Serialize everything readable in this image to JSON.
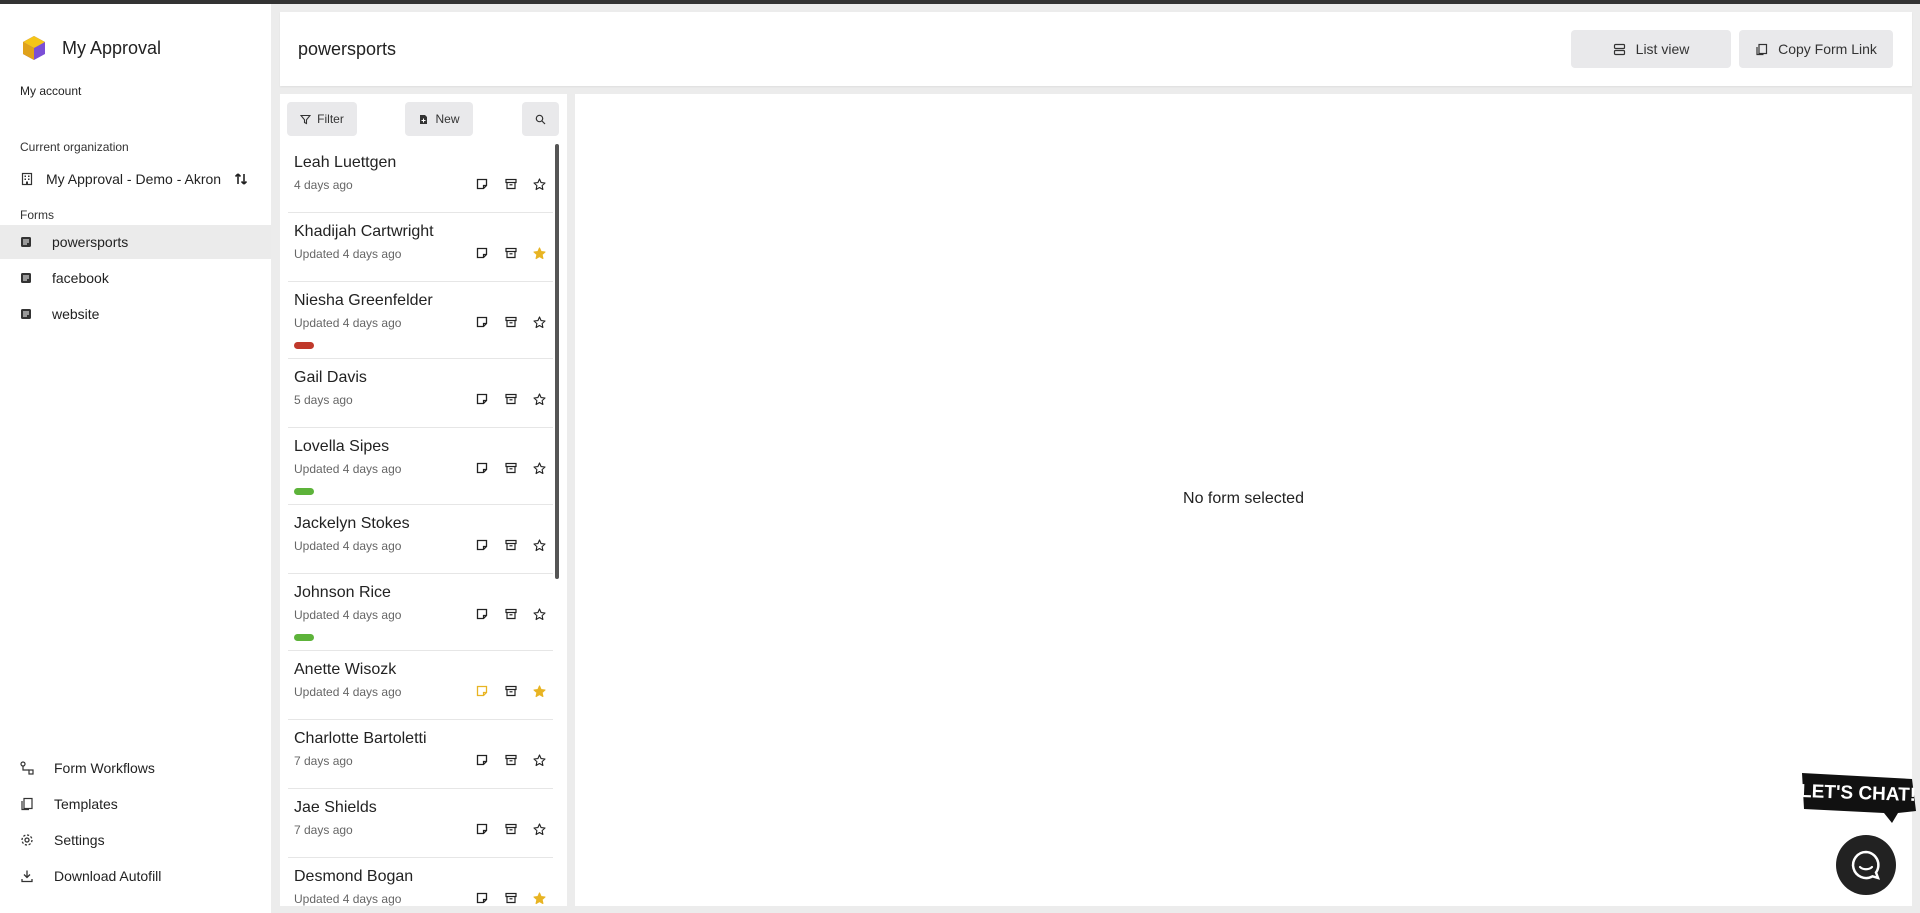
{
  "app": {
    "title": "My Approval",
    "brand_colors": [
      "#f5c518",
      "#7b4fd6"
    ]
  },
  "sidebar": {
    "my_account": "My account",
    "current_org_label": "Current organization",
    "org_name": "My Approval - Demo - Akron",
    "forms_label": "Forms",
    "forms": [
      {
        "label": "powersports",
        "active": true
      },
      {
        "label": "facebook",
        "active": false
      },
      {
        "label": "website",
        "active": false
      }
    ],
    "bottom": [
      {
        "label": "Form Workflows",
        "icon": "workflow-icon"
      },
      {
        "label": "Templates",
        "icon": "copy-icon"
      },
      {
        "label": "Settings",
        "icon": "gear-icon"
      },
      {
        "label": "Download Autofill",
        "icon": "download-icon"
      }
    ]
  },
  "header": {
    "title": "powersports",
    "list_view_label": "List view",
    "copy_link_label": "Copy Form Link"
  },
  "toolbar": {
    "filter_label": "Filter",
    "new_label": "New"
  },
  "entries": [
    {
      "name": "Leah Luettgen",
      "time": "4 days ago",
      "starred": false,
      "note_highlight": false,
      "tag": null
    },
    {
      "name": "Khadijah Cartwright",
      "time": "Updated 4 days ago",
      "starred": true,
      "note_highlight": false,
      "tag": null
    },
    {
      "name": "Niesha Greenfelder",
      "time": "Updated 4 days ago",
      "starred": false,
      "note_highlight": false,
      "tag": "#c0392b"
    },
    {
      "name": "Gail Davis",
      "time": "5 days ago",
      "starred": false,
      "note_highlight": false,
      "tag": null
    },
    {
      "name": "Lovella Sipes",
      "time": "Updated 4 days ago",
      "starred": false,
      "note_highlight": false,
      "tag": "#5db33a"
    },
    {
      "name": "Jackelyn Stokes",
      "time": "Updated 4 days ago",
      "starred": false,
      "note_highlight": false,
      "tag": null
    },
    {
      "name": "Johnson Rice",
      "time": "Updated 4 days ago",
      "starred": false,
      "note_highlight": false,
      "tag": "#5db33a"
    },
    {
      "name": "Anette Wisozk",
      "time": "Updated 4 days ago",
      "starred": true,
      "note_highlight": true,
      "tag": null
    },
    {
      "name": "Charlotte Bartoletti",
      "time": "7 days ago",
      "starred": false,
      "note_highlight": false,
      "tag": null
    },
    {
      "name": "Jae Shields",
      "time": "7 days ago",
      "starred": false,
      "note_highlight": false,
      "tag": null
    },
    {
      "name": "Desmond Bogan",
      "time": "Updated 4 days ago",
      "starred": true,
      "note_highlight": false,
      "tag": null
    }
  ],
  "detail": {
    "empty_message": "No form selected"
  },
  "chat": {
    "sign_text": "LET'S CHAT!"
  },
  "colors": {
    "star_active": "#e8b423",
    "note_active": "#e8b423"
  }
}
